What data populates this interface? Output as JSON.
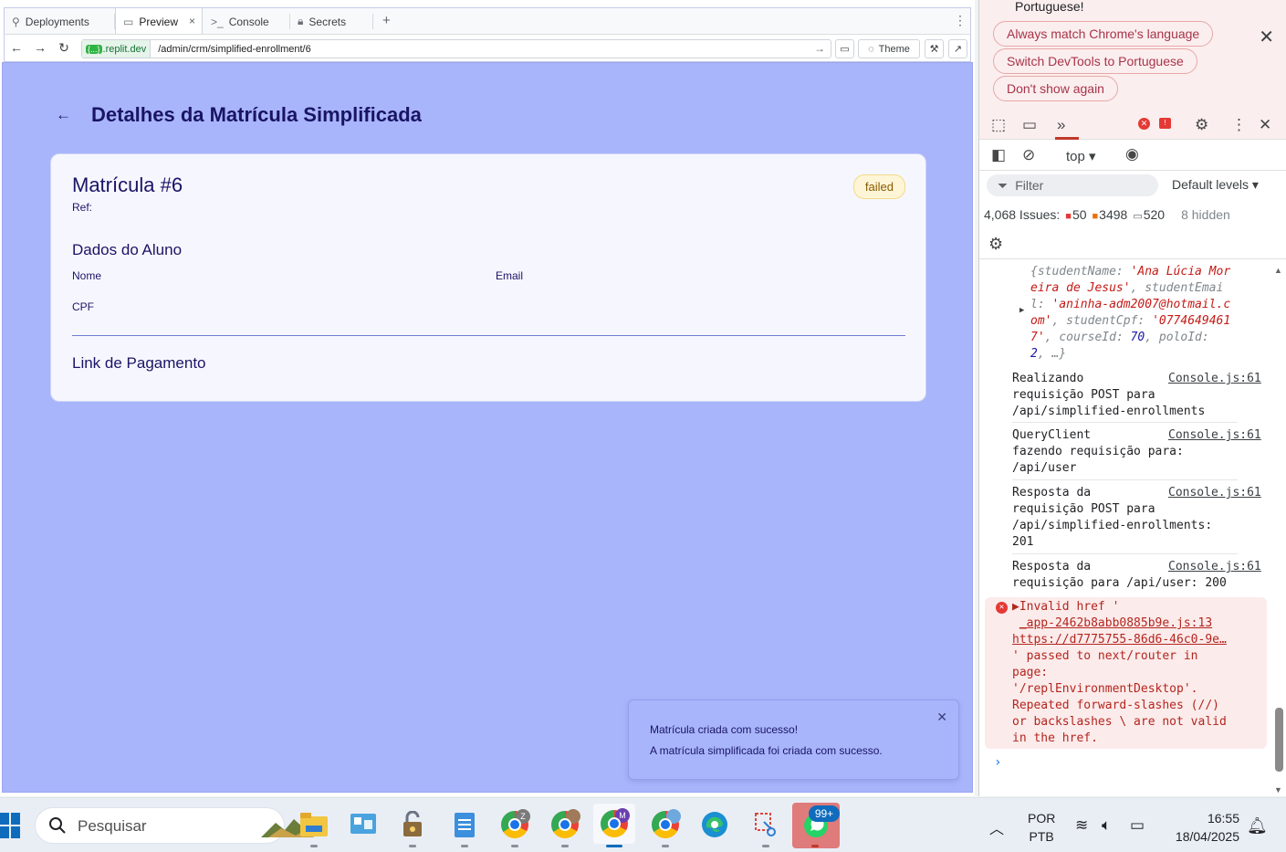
{
  "browser": {
    "tabs": [
      {
        "label": "Deployments",
        "icon": "deployments-icon"
      },
      {
        "label": "Preview",
        "icon": "preview-icon"
      },
      {
        "label": "Console",
        "icon": "console-icon"
      },
      {
        "label": "Secrets",
        "icon": "lock-icon"
      }
    ],
    "tab_close": "×",
    "tab_add": "+",
    "url_badge": "{...}",
    "url_host": ".replit.dev",
    "url_path": "/admin/crm/simplified-enrollment/6",
    "theme_label": "Theme"
  },
  "page": {
    "title": "Detalhes da Matrícula Simplificada",
    "card_title": "Matrícula #6",
    "ref_label": "Ref:",
    "status": "failed",
    "section_student": "Dados do Aluno",
    "label_name": "Nome",
    "label_email": "Email",
    "label_cpf": "CPF",
    "section_payment": "Link de Pagamento"
  },
  "toast": {
    "title": "Matrícula criada com sucesso!",
    "description": "A matrícula simplificada foi criada com sucesso."
  },
  "devtools": {
    "lang_text": "Portuguese!",
    "lang_buttons": [
      "Always match Chrome's language",
      "Switch DevTools to Portuguese",
      "Don't show again"
    ],
    "context": "top ▾",
    "filter_placeholder": "Filter",
    "levels": "Default levels ▾",
    "issues_label": "4,068 Issues:",
    "issues_red": "50",
    "issues_orange": "3498",
    "issues_gray": "520",
    "hidden": "8 hidden",
    "obj_entry": {
      "k1": "studentName",
      "v1": "'Ana Lúcia Moreira de Jesus'",
      "k2": "studentEmail",
      "v2": "'aninha-adm2007@hotmail.com'",
      "k3": "studentCpf",
      "v3": "'07746494617'",
      "k4": "courseId",
      "v4": "70",
      "k5": "poloId",
      "v5": "2"
    },
    "logs": [
      {
        "text": "Realizando\nrequisição POST para\n/api/simplified-enrollments",
        "src": "Console.js:61"
      },
      {
        "text": "QueryClient\nfazendo requisição para:\n/api/user",
        "src": "Console.js:61"
      },
      {
        "text": "Resposta da\nrequisição POST para\n/api/simplified-enrollments:\n201",
        "src": "Console.js:61"
      },
      {
        "text": "Resposta da\nrequisição para /api/user: 200",
        "src": "Console.js:61"
      }
    ],
    "error": {
      "head": "Invalid href '",
      "src": "_app-2462b8abb0885b9e.js:13",
      "link": "https://d7775755-86d6-46c0-9e…",
      "body": "' passed to next/router in\npage:\n'/replEnvironmentDesktop'.\nRepeated forward-slashes (//)\nor backslashes \\ are not valid\nin the href."
    }
  },
  "taskbar": {
    "search_placeholder": "Pesquisar",
    "lang_line1": "POR",
    "lang_line2": "PTB",
    "time": "16:55",
    "date": "18/04/2025",
    "whatsapp_badge": "99+",
    "chrome_avatars": [
      "Z",
      "",
      "M",
      ""
    ],
    "colors": {
      "accent": "#0f6cbd",
      "page_bg": "#a8b5fb",
      "title": "#1a1466"
    }
  }
}
